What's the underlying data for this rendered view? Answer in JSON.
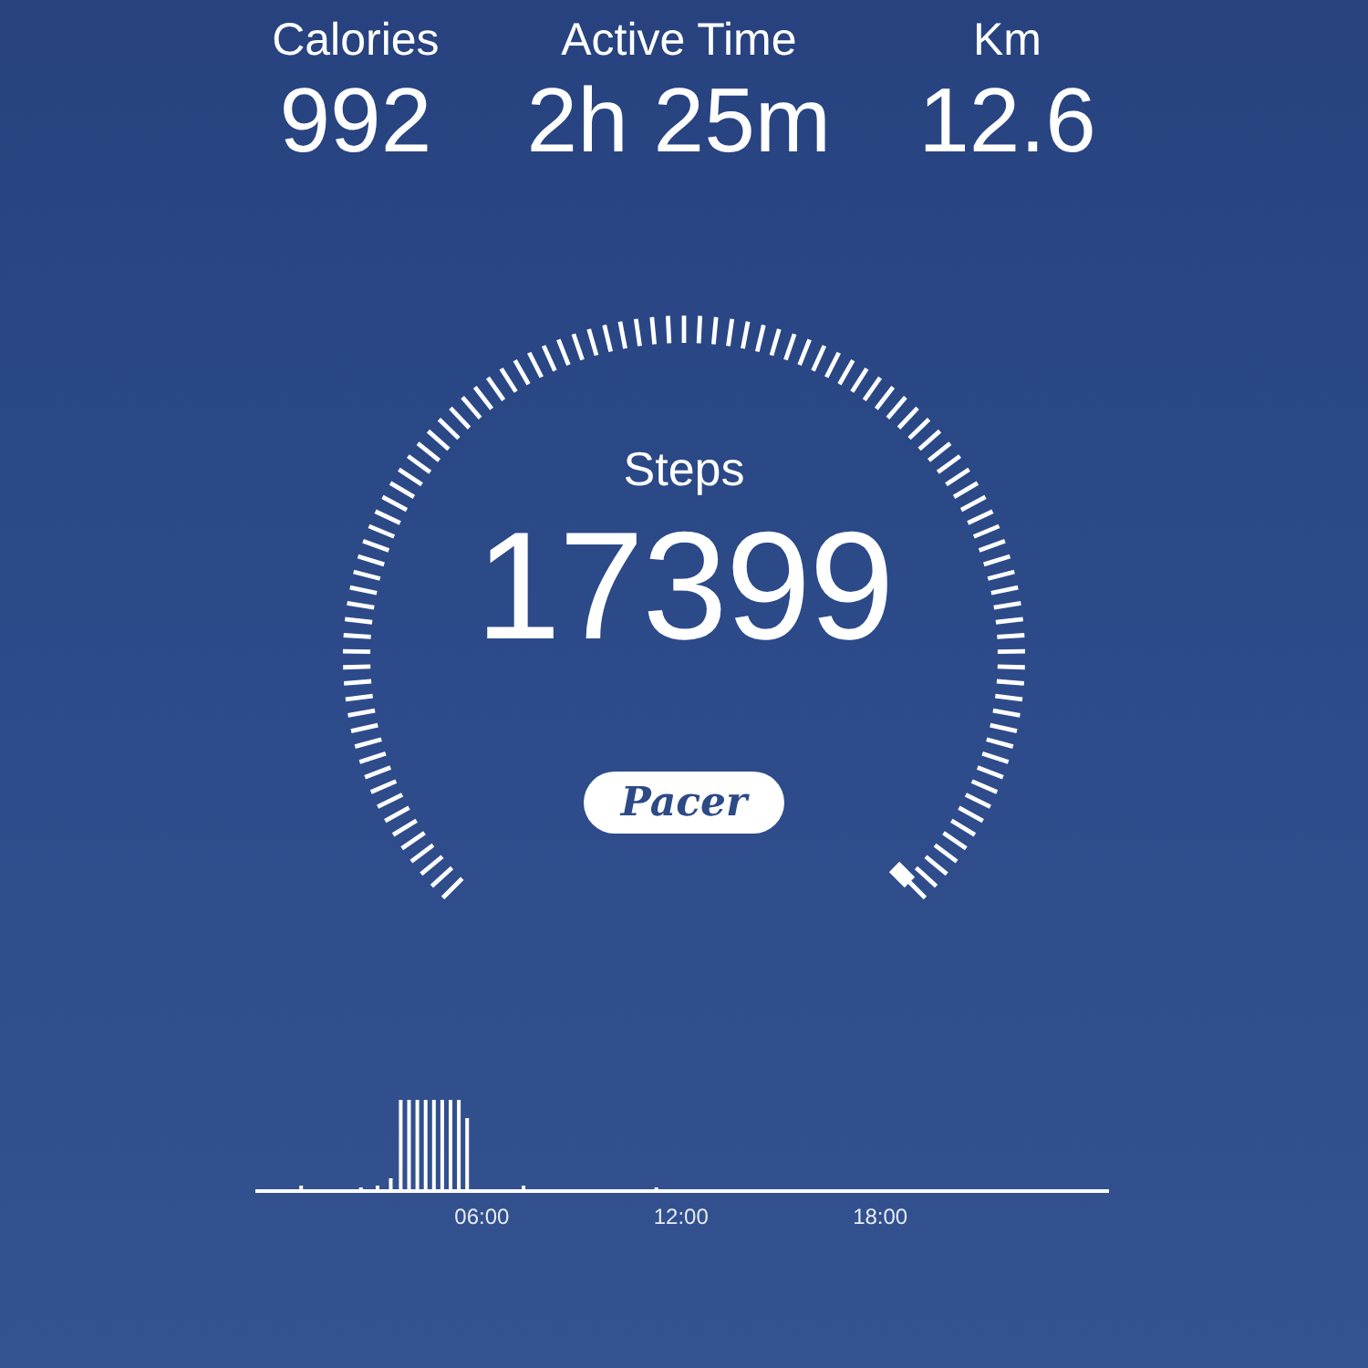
{
  "stats": [
    {
      "label": "Calories",
      "value": "992"
    },
    {
      "label": "Active Time",
      "value": "2h 25m"
    },
    {
      "label": "Km",
      "value": "12.6"
    }
  ],
  "gauge": {
    "label": "Steps",
    "value": "17399"
  },
  "logo": "Pacer",
  "activity_chart": {
    "time_labels": [
      "06:00",
      "12:00",
      "18:00"
    ]
  }
}
